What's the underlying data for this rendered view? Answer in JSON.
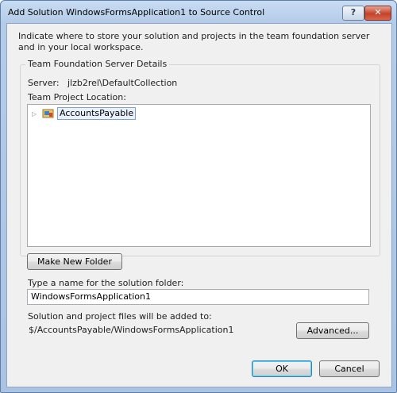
{
  "window": {
    "title": "Add Solution WindowsFormsApplication1 to Source Control",
    "help_icon": "?",
    "close_icon": "✕"
  },
  "instruction": "Indicate where to store your solution and projects in the team foundation server and in your local workspace.",
  "group": {
    "legend": "Team Foundation Server Details",
    "server_label": "Server:",
    "server_value": "jlzb2rel\\DefaultCollection",
    "location_label": "Team Project Location:",
    "tree": {
      "expander_icon": "▷",
      "node_icon": "team-project-icon",
      "node_label": "AccountsPayable"
    }
  },
  "buttons": {
    "make_new_folder": "Make New Folder",
    "advanced": "Advanced...",
    "ok": "OK",
    "cancel": "Cancel"
  },
  "folder": {
    "label": "Type a name for the solution folder:",
    "value": "WindowsFormsApplication1"
  },
  "files": {
    "label": "Solution and project files will be added to:",
    "path": "$/AccountsPayable/WindowsFormsApplication1"
  },
  "colors": {
    "title_gradient_top": "#c8dcf2",
    "client_bg": "#f0f0f0",
    "close_red": "#c5412a"
  }
}
